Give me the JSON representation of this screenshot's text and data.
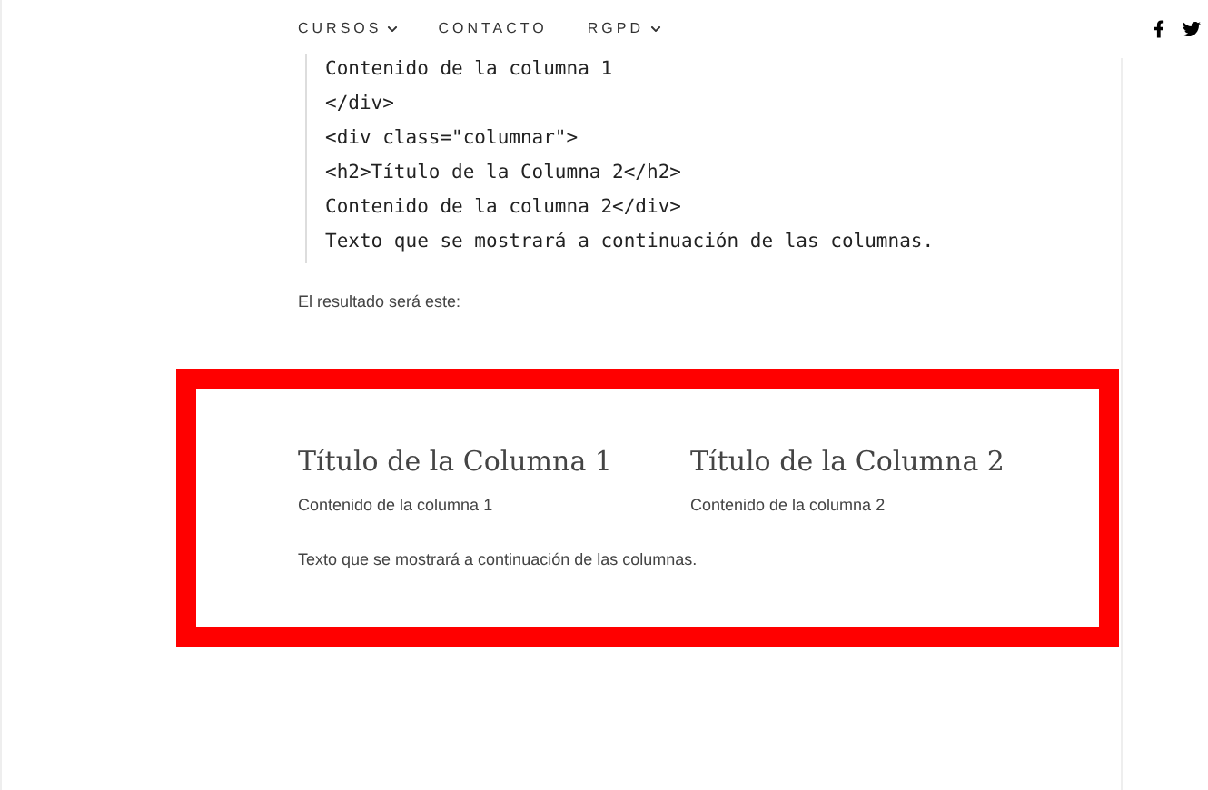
{
  "nav": {
    "items": [
      {
        "label": "CURSOS",
        "dropdown": true
      },
      {
        "label": "CONTACTO",
        "dropdown": false
      },
      {
        "label": "RGPD",
        "dropdown": true
      }
    ]
  },
  "code_lines": [
    "Contenido de la columna 1",
    "</div>",
    "<div class=\"columnar\">",
    "<h2>Título de la Columna 2</h2>",
    "Contenido de la columna 2</div>",
    "Texto que se mostrará a continuación de las columnas."
  ],
  "result_intro": "El resultado será este:",
  "result": {
    "columns": [
      {
        "title": "Título de la Columna 1",
        "content": "Contenido de la columna 1"
      },
      {
        "title": "Título de la Columna 2",
        "content": "Contenido de la columna 2"
      }
    ],
    "footer_text": "Texto que se mostrará a continuación de las columnas."
  }
}
